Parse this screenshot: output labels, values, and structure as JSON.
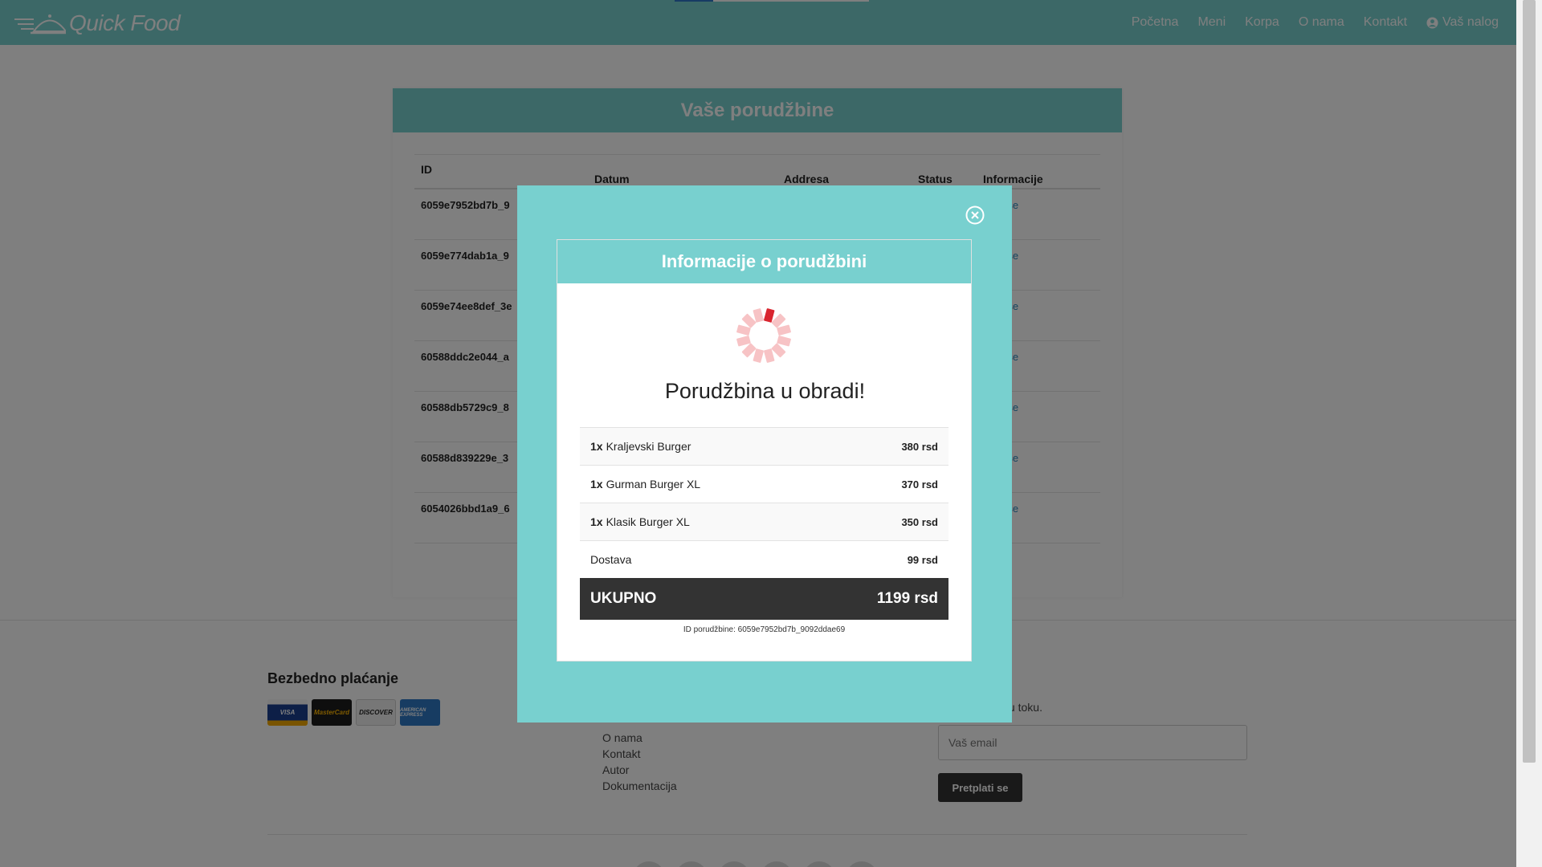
{
  "nav": {
    "brand": "Quick Food",
    "links": [
      "Početna",
      "Meni",
      "Korpa",
      "O nama",
      "Kontakt"
    ],
    "account": "Vaš nalog"
  },
  "orders": {
    "title": "Vaše porudžbine",
    "columns": {
      "id": "ID",
      "date": "Datum",
      "address": "Addresa",
      "status": "Status",
      "info": "Informacije"
    },
    "rows": [
      {
        "id": "6059e7952bd7b_9",
        "info": "daj više"
      },
      {
        "id": "6059e774dab1a_9",
        "info": "daj više"
      },
      {
        "id": "6059e74ee8def_3e",
        "info": "daj više"
      },
      {
        "id": "60588ddc2e044_a",
        "info": "daj više"
      },
      {
        "id": "60588db5729c9_8",
        "info": "daj više"
      },
      {
        "id": "60588d839229e_3",
        "info": "daj više"
      },
      {
        "id": "6054026bbd1a9_6",
        "info": "daj više"
      }
    ]
  },
  "footer": {
    "payment_title": "Bezbedno plaćanje",
    "cards": [
      "VISA",
      "MasterCard",
      "DISCOVER",
      "AMERICAN EXPRESS"
    ],
    "links": [
      "O nama",
      "Kontakt",
      "Autor",
      "Dokumentacija"
    ],
    "newsletter_text": "kako biste bili u toku.",
    "email_placeholder": "Vaš email",
    "subscribe_label": "Pretplati se"
  },
  "modal": {
    "title": "Informacije o porudžbini",
    "status": "Porudžbina u obradi!",
    "items": [
      {
        "qty": "1x",
        "name": "Kraljevski Burger",
        "price": "380 rsd"
      },
      {
        "qty": "1x",
        "name": "Gurman Burger XL",
        "price": "370 rsd"
      },
      {
        "qty": "1x",
        "name": "Klasik Burger XL",
        "price": "350 rsd"
      }
    ],
    "delivery": {
      "label": "Dostava",
      "price": "99 rsd"
    },
    "total": {
      "label": "UKUPNO",
      "price": "1199 rsd"
    },
    "order_id": "ID porudžbine: 6059e7952bd7b_9092ddae69"
  },
  "colors": {
    "accent": "#78d0cf",
    "dark": "#333333",
    "link": "#2a8bbf",
    "spinner_active": "#d9252f",
    "spinner_inactive": "#f7c3c5"
  }
}
